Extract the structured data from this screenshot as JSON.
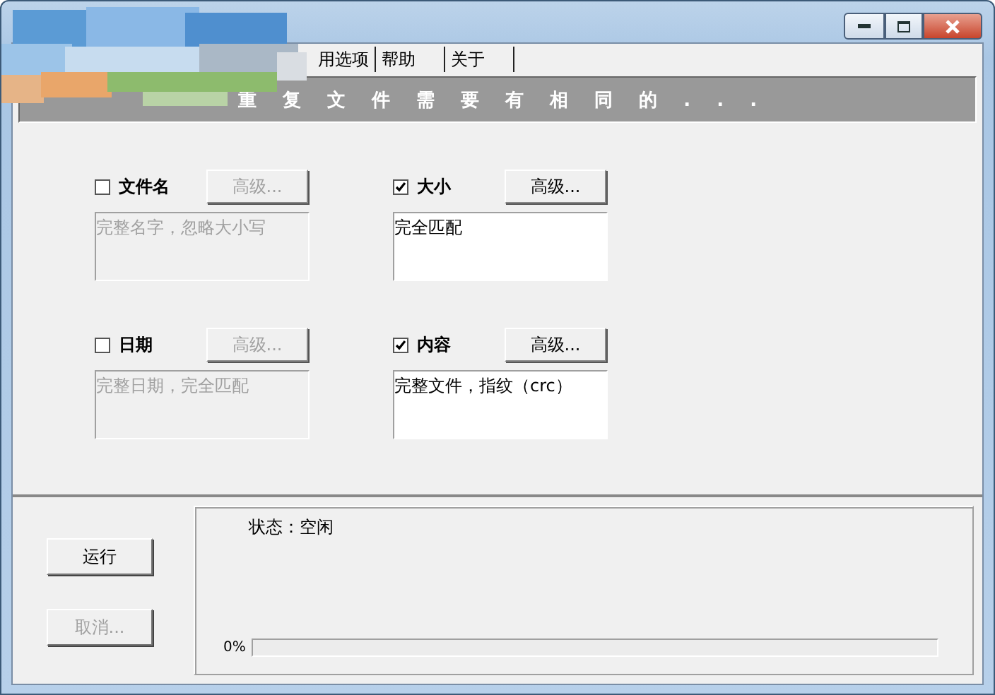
{
  "tabs": [
    {
      "label": "用选项"
    },
    {
      "label": "帮助"
    },
    {
      "label": "关于"
    }
  ],
  "banner": "重 复 文 件 需 要 有 相 同 的 . . .",
  "criteria": [
    {
      "label": "文件名",
      "checked": false,
      "button": "高级...",
      "description": "完整名字，忽略大小写"
    },
    {
      "label": "大小",
      "checked": true,
      "button": "高级...",
      "description": "完全匹配"
    },
    {
      "label": "日期",
      "checked": false,
      "button": "高级...",
      "description": "完整日期，完全匹配"
    },
    {
      "label": "内容",
      "checked": true,
      "button": "高级...",
      "description": "完整文件，指纹（crc）"
    }
  ],
  "actions": [
    {
      "label": "运行",
      "disabled": false
    },
    {
      "label": "取消...",
      "disabled": true
    }
  ],
  "status": "状态：空闲",
  "progress": {
    "reading": "0%",
    "level": 0
  }
}
